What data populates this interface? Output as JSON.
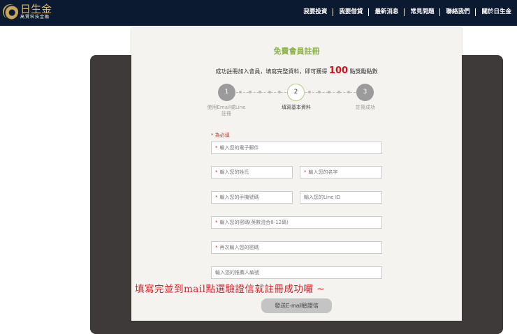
{
  "nav": {
    "logo_name": "日生金",
    "logo_sub": "高賢科技金融",
    "items": [
      "我要投資",
      "我要借貸",
      "最新消息",
      "常見問題",
      "聯絡我們",
      "關於日生金"
    ]
  },
  "form": {
    "title": "免費會員註冊",
    "subtitle_pre": "成功註冊加入會員，填寫完整資料，即可獲得",
    "points": "100",
    "subtitle_post": "點獎勵點數",
    "steps": [
      {
        "num": "1",
        "label": "使用Email或Line註冊"
      },
      {
        "num": "2",
        "label": "填寫基本資料"
      },
      {
        "num": "3",
        "label": "註冊成功"
      }
    ],
    "required_note": "* 為必填",
    "fields": {
      "email": "輸入您的電子郵件",
      "last_name": "輸入您的姓氏",
      "first_name": "輸入您的名字",
      "phone": "輸入您的手機號碼",
      "line_id": "輸入您的Line ID",
      "password": "輸入您的密碼(英數混合8-12碼)",
      "password_confirm": "再次輸入您的密碼",
      "referrer": "輸入您的推薦人編號"
    },
    "submit": "發送E-mail驗證信"
  },
  "annotation": "填寫完並到mail點選驗證信就註冊成功囉 ~"
}
